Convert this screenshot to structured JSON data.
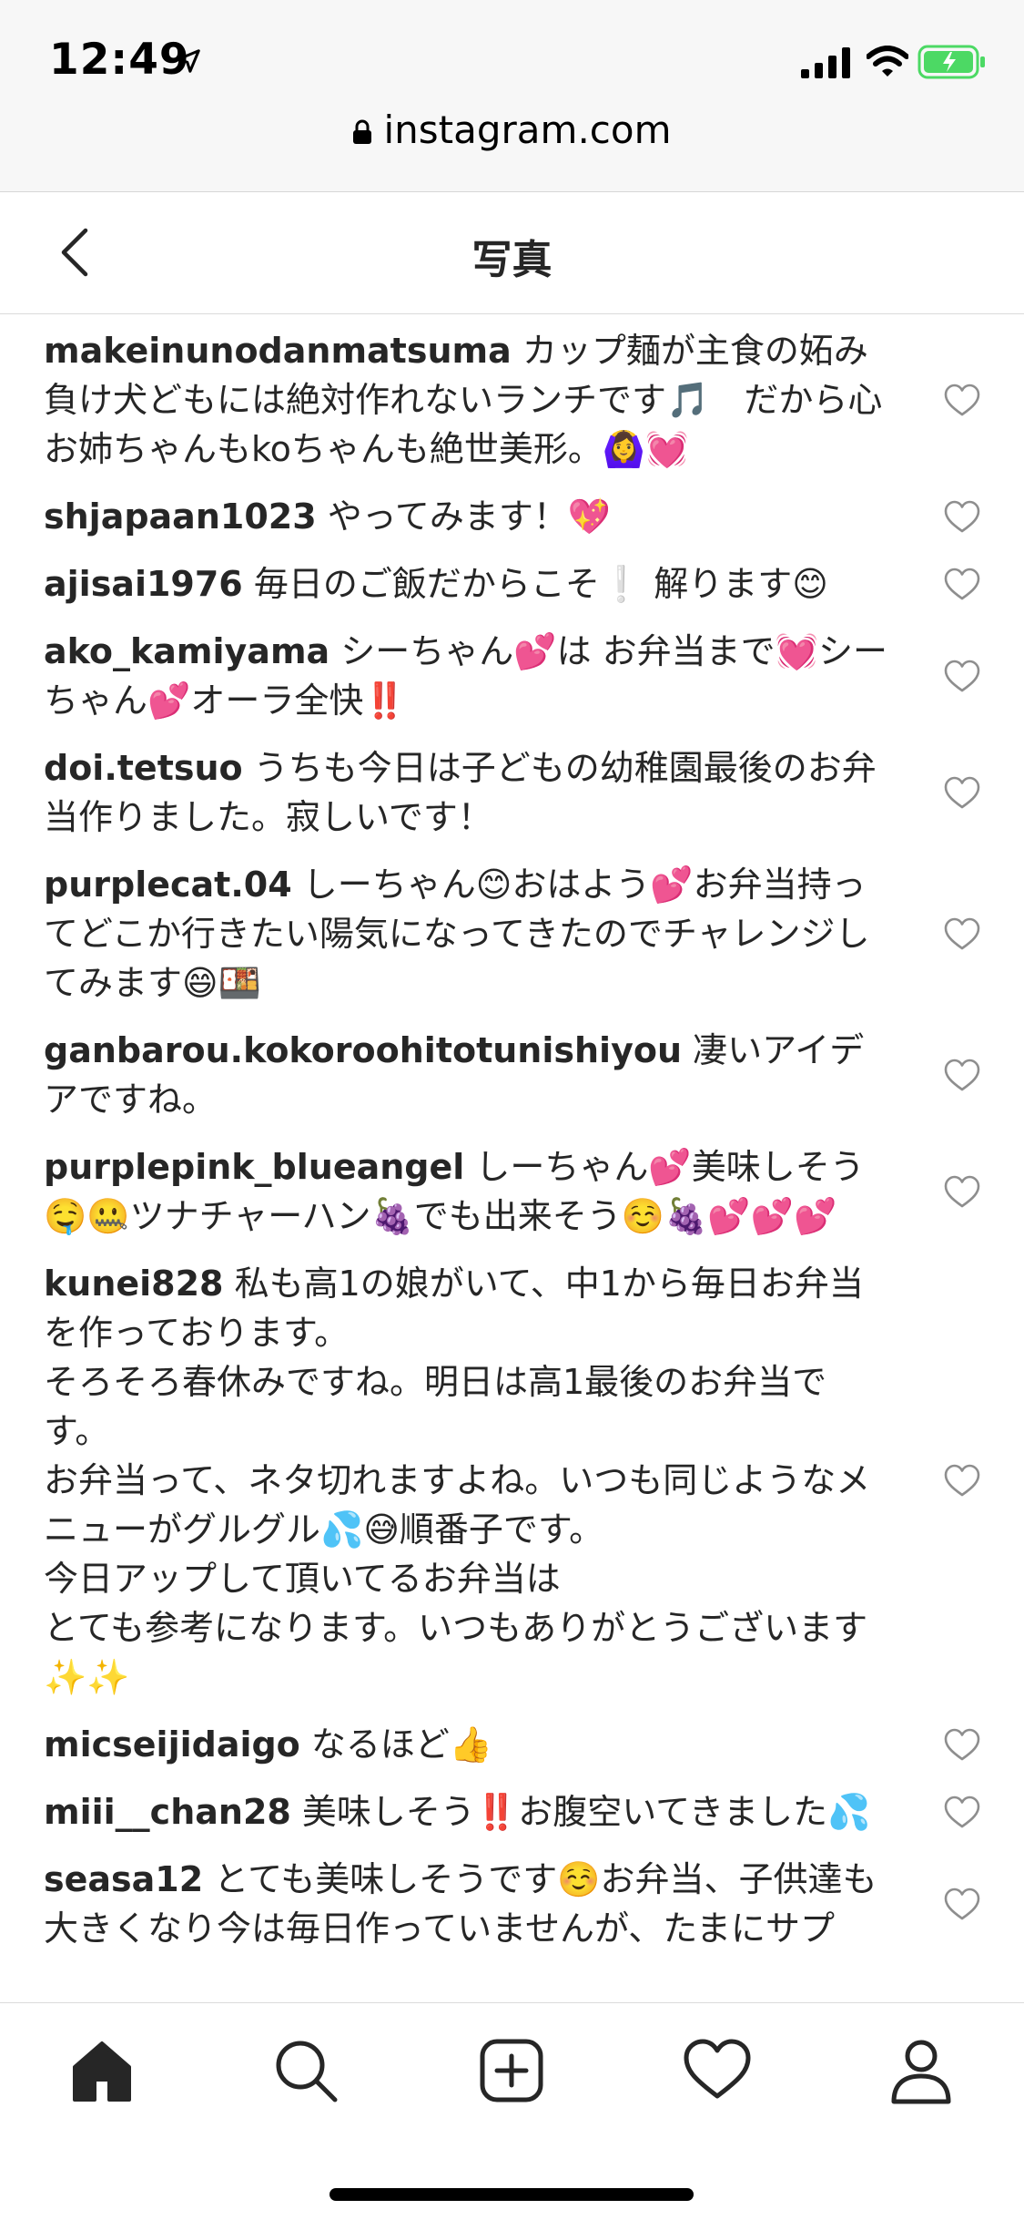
{
  "status_bar": {
    "time": "12:49",
    "url": "instagram.com"
  },
  "header": {
    "title": "写真"
  },
  "comments": [
    {
      "user": "makeinunodanmatsuma",
      "text": " カップ麺が主食の妬み負け犬どもには絶対作れないランチです🎵　だから心お姉ちゃんもkoちゃんも絶世美形。🙆‍♀️💓"
    },
    {
      "user": "shjapaan1023",
      "text": " やってみます！💖"
    },
    {
      "user": "ajisai1976",
      "text": " 毎日のご飯だからこそ❕ 解ります😊"
    },
    {
      "user": "ako_kamiyama",
      "text": " シーちゃん💕は お弁当まで💓シーちゃん💕オーラ全快‼️"
    },
    {
      "user": "doi.tetsuo",
      "text": " うちも今日は子どもの幼稚園最後のお弁当作りました。寂しいです！"
    },
    {
      "user": "purplecat.04",
      "text": " しーちゃん😊おはよう💕お弁当持ってどこか行きたい陽気になってきたのでチャレンジしてみます😄🍱"
    },
    {
      "user": "ganbarou.kokoroohitotunishiyou",
      "text": " 凄いアイデアですね。"
    },
    {
      "user": "purplepink_blueangel",
      "text": " しーちゃん💕美味しそう🤤🤐ツナチャーハン🍇でも出来そう☺️🍇💕💕💕"
    },
    {
      "user": "kunei828",
      "text": " 私も高1の娘がいて、中1から毎日お弁当を作っております。\nそろそろ春休みですね。明日は高1最後のお弁当です。\nお弁当って、ネタ切れますよね。いつも同じようなメニューがグルグル💦😅順番子です。\n今日アップして頂いてるお弁当は\nとても参考になります。いつもありがとうございます✨✨"
    },
    {
      "user": "micseijidaigo",
      "text": " なるほど👍"
    },
    {
      "user": "miii__chan28",
      "text": " 美味しそう‼️お腹空いてきました💦"
    },
    {
      "user": "seasa12",
      "text": " とても美味しそうです☺️お弁当、子供達も大きくなり今は毎日作っていませんが、たまにサプ"
    }
  ],
  "icons": {
    "back": "chevron-left-icon",
    "like": "heart-outline-icon",
    "tabs": [
      "home-icon",
      "search-icon",
      "new-post-icon",
      "activity-heart-icon",
      "profile-icon"
    ]
  },
  "colors": {
    "text": "#262626",
    "battery": "#4cd964",
    "divider": "#dbdbdb"
  }
}
